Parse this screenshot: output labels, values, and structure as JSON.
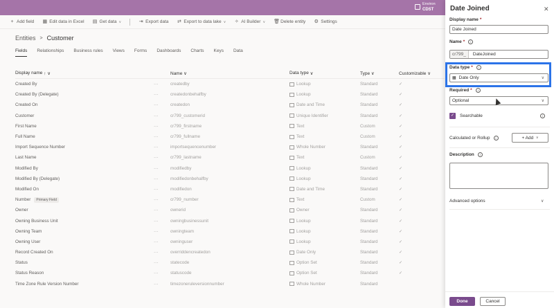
{
  "topbar": {
    "env_line1": "Environ",
    "env_line2": "CDST"
  },
  "commands": [
    {
      "icon": "plus-icon",
      "label": "Add field",
      "chevron": false
    },
    {
      "icon": "excel-icon",
      "label": "Edit data in Excel",
      "chevron": false
    },
    {
      "icon": "database-icon",
      "label": "Get data",
      "chevron": true
    },
    {
      "icon": "export-icon",
      "label": "Export data",
      "chevron": false
    },
    {
      "icon": "export-lake-icon",
      "label": "Export to data lake",
      "chevron": true
    },
    {
      "icon": "ai-icon",
      "label": "AI Builder",
      "chevron": true
    },
    {
      "icon": "trash-icon",
      "label": "Delete entity",
      "chevron": false
    },
    {
      "icon": "gear-icon",
      "label": "Settings",
      "chevron": false
    }
  ],
  "breadcrumb": {
    "root": "Entities",
    "separator": ">",
    "current": "Customer"
  },
  "tabs": [
    "Fields",
    "Relationships",
    "Business rules",
    "Views",
    "Forms",
    "Dashboards",
    "Charts",
    "Keys",
    "Data"
  ],
  "columns": {
    "display_name": "Display name",
    "display_name_sort": "↑ ∨",
    "name": "Name",
    "name_sort": "∨",
    "data_type": "Data type",
    "data_type_sort": "∨",
    "type": "Type",
    "type_sort": "∨",
    "customizable": "Customizable",
    "customizable_sort": "∨"
  },
  "rows": [
    {
      "display": "Created By",
      "badge": "",
      "more": "···",
      "name": "createdby",
      "dtype": "Lookup",
      "type": "Standard",
      "check": "✓"
    },
    {
      "display": "Created By (Delegate)",
      "badge": "",
      "more": "···",
      "name": "createdonbehalfby",
      "dtype": "Lookup",
      "type": "Standard",
      "check": "✓"
    },
    {
      "display": "Created On",
      "badge": "",
      "more": "···",
      "name": "createdon",
      "dtype": "Date and Time",
      "type": "Standard",
      "check": "✓"
    },
    {
      "display": "Customer",
      "badge": "",
      "more": "···",
      "name": "cr799_customerid",
      "dtype": "Unique Identifier",
      "type": "Standard",
      "check": "✓"
    },
    {
      "display": "First Name",
      "badge": "",
      "more": "···",
      "name": "cr799_firstname",
      "dtype": "Text",
      "type": "Custom",
      "check": "✓"
    },
    {
      "display": "Full Name",
      "badge": "",
      "more": "···",
      "name": "cr799_fullname",
      "dtype": "Text",
      "type": "Custom",
      "check": "✓"
    },
    {
      "display": "Import Sequence Number",
      "badge": "",
      "more": "···",
      "name": "importsequencenumber",
      "dtype": "Whole Number",
      "type": "Standard",
      "check": "✓"
    },
    {
      "display": "Last Name",
      "badge": "",
      "more": "···",
      "name": "cr799_lastname",
      "dtype": "Text",
      "type": "Custom",
      "check": "✓"
    },
    {
      "display": "Modified By",
      "badge": "",
      "more": "···",
      "name": "modifiedby",
      "dtype": "Lookup",
      "type": "Standard",
      "check": "✓"
    },
    {
      "display": "Modified By (Delegate)",
      "badge": "",
      "more": "···",
      "name": "modifiedonbehalfby",
      "dtype": "Lookup",
      "type": "Standard",
      "check": "✓"
    },
    {
      "display": "Modified On",
      "badge": "",
      "more": "···",
      "name": "modifiedon",
      "dtype": "Date and Time",
      "type": "Standard",
      "check": "✓"
    },
    {
      "display": "Number",
      "badge": "Primary Field",
      "more": "···",
      "name": "cr799_number",
      "dtype": "Text",
      "type": "Custom",
      "check": "✓"
    },
    {
      "display": "Owner",
      "badge": "",
      "more": "···",
      "name": "ownerid",
      "dtype": "Owner",
      "type": "Standard",
      "check": "✓"
    },
    {
      "display": "Owning Business Unit",
      "badge": "",
      "more": "···",
      "name": "owningbusinessunit",
      "dtype": "Lookup",
      "type": "Standard",
      "check": "✓"
    },
    {
      "display": "Owning Team",
      "badge": "",
      "more": "···",
      "name": "owningteam",
      "dtype": "Lookup",
      "type": "Standard",
      "check": "✓"
    },
    {
      "display": "Owning User",
      "badge": "",
      "more": "···",
      "name": "owninguser",
      "dtype": "Lookup",
      "type": "Standard",
      "check": "✓"
    },
    {
      "display": "Record Created On",
      "badge": "",
      "more": "···",
      "name": "overriddencreatedon",
      "dtype": "Date Only",
      "type": "Standard",
      "check": "✓"
    },
    {
      "display": "Status",
      "badge": "",
      "more": "···",
      "name": "statecode",
      "dtype": "Option Set",
      "type": "Standard",
      "check": "✓"
    },
    {
      "display": "Status Reason",
      "badge": "",
      "more": "···",
      "name": "statuscode",
      "dtype": "Option Set",
      "type": "Standard",
      "check": "✓"
    },
    {
      "display": "Time Zone Rule Version Number",
      "badge": "",
      "more": "···",
      "name": "timezoneruleversionnumber",
      "dtype": "Whole Number",
      "type": "Standard",
      "check": ""
    }
  ],
  "panel": {
    "title": "Date Joined",
    "close": "✕",
    "display_name_label": "Display name",
    "display_name_value": "Date Joined",
    "name_label": "Name",
    "name_prefix": "cr799_",
    "name_value": "DateJoined",
    "data_type_label": "Data type",
    "data_type_value": "Date Only",
    "required_label": "Required",
    "required_value": "Optional",
    "searchable_label": "Searchable",
    "calc_label": "Calculated or Rollup",
    "add_label": "+ Add",
    "add_chevron": "∨",
    "description_label": "Description",
    "advanced_label": "Advanced options",
    "done_label": "Done",
    "cancel_label": "Cancel"
  },
  "colors": {
    "topbar": "#a574a8",
    "primary": "#7a4b8d",
    "highlight": "#2b73e8"
  }
}
